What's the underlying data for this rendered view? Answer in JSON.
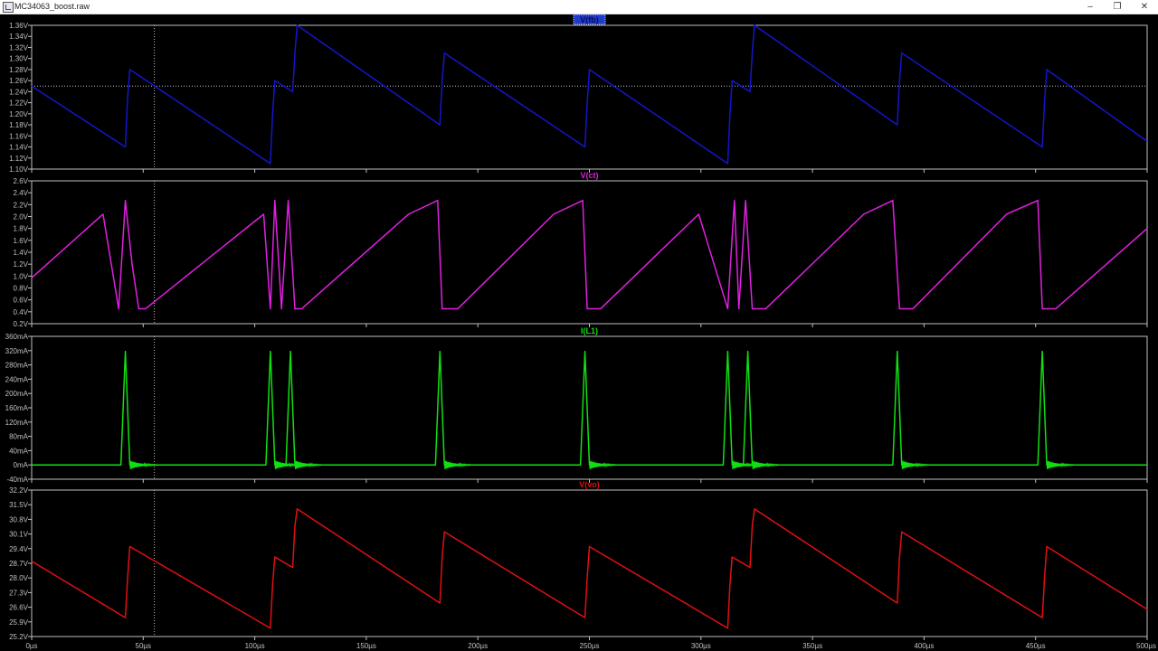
{
  "window": {
    "title": "MC34063_boost.raw",
    "icons": {
      "app": "ltspice-waveform-icon",
      "minimize": "minimize-icon",
      "maximize": "restore-icon",
      "close": "close-icon"
    },
    "buttons": {
      "minimize": "–",
      "maximize": "❐",
      "close": "✕"
    }
  },
  "colors": {
    "background": "#000000",
    "axis": "#c0c0c0",
    "grid": "#7a7a7a",
    "cursor": "#bdbdbd"
  },
  "xaxis": {
    "ticks": [
      "0µs",
      "50µs",
      "100µs",
      "150µs",
      "200µs",
      "250µs",
      "300µs",
      "350µs",
      "400µs",
      "450µs",
      "500µs"
    ],
    "range_us": [
      0,
      500
    ]
  },
  "cursor": {
    "x_us": 55
  },
  "chart_data": [
    {
      "type": "line",
      "title": "V(fb)",
      "title_highlighted": true,
      "color": "#1515cc",
      "ylim": [
        1.1,
        1.36
      ],
      "yticks": [
        "1.10V",
        "1.12V",
        "1.14V",
        "1.16V",
        "1.18V",
        "1.20V",
        "1.22V",
        "1.24V",
        "1.26V",
        "1.28V",
        "1.30V",
        "1.32V",
        "1.34V",
        "1.36V"
      ],
      "hline": 1.25,
      "x": [
        0,
        42,
        43,
        44,
        107,
        108,
        109,
        117,
        118,
        119,
        183,
        184,
        185,
        248,
        249,
        250,
        312,
        313,
        314,
        322,
        323,
        324,
        388,
        389,
        390,
        453,
        454,
        455,
        500
      ],
      "y": [
        1.25,
        1.14,
        1.23,
        1.28,
        1.11,
        1.2,
        1.26,
        1.24,
        1.31,
        1.36,
        1.18,
        1.26,
        1.31,
        1.14,
        1.22,
        1.28,
        1.11,
        1.2,
        1.26,
        1.24,
        1.31,
        1.36,
        1.18,
        1.26,
        1.31,
        1.14,
        1.22,
        1.28,
        1.15
      ]
    },
    {
      "type": "line",
      "title": "V(ct)",
      "title_highlighted": false,
      "color": "#e020e0",
      "ylim": [
        0.2,
        2.6
      ],
      "yticks": [
        "0.2V",
        "0.4V",
        "0.6V",
        "0.8V",
        "1.0V",
        "1.2V",
        "1.4V",
        "1.6V",
        "1.8V",
        "2.0V",
        "2.2V",
        "2.4V",
        "2.6V"
      ],
      "x": [
        0,
        32,
        39,
        42,
        45,
        48,
        51,
        104,
        107,
        109,
        112,
        115,
        118,
        121,
        169,
        182,
        184,
        187,
        191,
        234,
        247,
        249,
        252,
        255,
        299,
        312,
        315,
        317,
        320,
        323,
        326,
        329,
        373,
        386,
        389,
        391,
        395,
        437,
        451,
        453,
        456,
        459,
        500
      ],
      "y": [
        0.97,
        2.04,
        0.45,
        2.27,
        1.2,
        0.45,
        0.45,
        2.04,
        0.45,
        2.27,
        0.45,
        2.27,
        0.45,
        0.45,
        2.04,
        2.27,
        0.45,
        0.45,
        0.45,
        2.04,
        2.27,
        0.45,
        0.45,
        0.45,
        2.04,
        0.45,
        2.27,
        0.45,
        2.27,
        0.45,
        0.45,
        0.45,
        2.04,
        2.27,
        0.45,
        0.45,
        0.45,
        2.04,
        2.27,
        0.45,
        0.45,
        0.45,
        1.8
      ]
    },
    {
      "type": "line",
      "title": "I(L1)",
      "title_highlighted": false,
      "color": "#10e010",
      "ylim": [
        -40,
        360
      ],
      "yticks": [
        "-40mA",
        "0mA",
        "40mA",
        "80mA",
        "120mA",
        "160mA",
        "200mA",
        "240mA",
        "280mA",
        "320mA",
        "360mA"
      ],
      "x": [
        0,
        40,
        42,
        44,
        46,
        105,
        107,
        109,
        114,
        116,
        118,
        120,
        181,
        183,
        185,
        187,
        246,
        248,
        250,
        252,
        310,
        312,
        314,
        319,
        321,
        323,
        325,
        386,
        388,
        390,
        392,
        451,
        453,
        455,
        457,
        500
      ],
      "y": [
        0,
        0,
        318,
        0,
        0,
        0,
        318,
        0,
        0,
        318,
        0,
        0,
        0,
        318,
        0,
        0,
        0,
        318,
        0,
        0,
        0,
        318,
        0,
        0,
        318,
        0,
        0,
        0,
        318,
        0,
        0,
        0,
        318,
        0,
        0,
        0
      ],
      "ringing_after_pulses_us": [
        44,
        109,
        118,
        185,
        250,
        314,
        323,
        390,
        455
      ]
    },
    {
      "type": "line",
      "title": "V(vo)",
      "title_highlighted": false,
      "color": "#e01010",
      "ylim": [
        25.2,
        32.2
      ],
      "yticks": [
        "25.2V",
        "25.9V",
        "26.6V",
        "27.3V",
        "28.0V",
        "28.7V",
        "29.4V",
        "30.1V",
        "30.8V",
        "31.5V",
        "32.2V"
      ],
      "x": [
        0,
        42,
        43,
        44,
        107,
        108,
        109,
        117,
        118,
        119,
        183,
        184,
        185,
        248,
        249,
        250,
        312,
        313,
        314,
        322,
        323,
        324,
        388,
        389,
        390,
        453,
        454,
        455,
        500
      ],
      "y": [
        28.8,
        26.1,
        28.0,
        29.5,
        25.6,
        27.7,
        29.0,
        28.5,
        30.5,
        31.3,
        26.8,
        29.0,
        30.2,
        26.1,
        28.0,
        29.5,
        25.6,
        27.7,
        29.0,
        28.5,
        30.5,
        31.3,
        26.8,
        29.0,
        30.2,
        26.1,
        28.0,
        29.5,
        26.5
      ]
    }
  ]
}
